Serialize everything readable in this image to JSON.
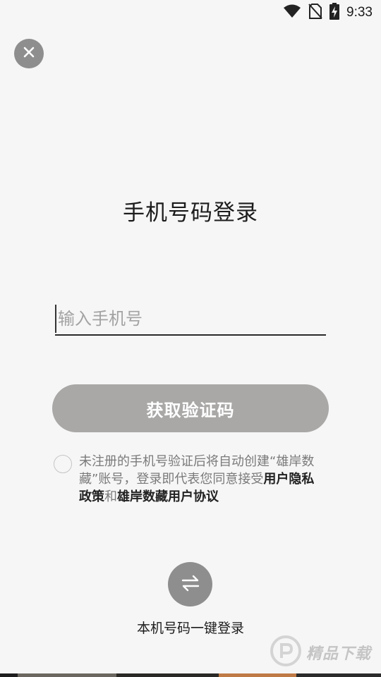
{
  "status_bar": {
    "time": "9:33",
    "icons": [
      "wifi-icon",
      "no-sim-icon",
      "battery-charging-icon"
    ]
  },
  "close_button": {
    "icon": "close-icon"
  },
  "page_title": "手机号码登录",
  "phone_input": {
    "value": "",
    "placeholder": "输入手机号"
  },
  "get_code_button": {
    "label": "获取验证码",
    "state": "disabled",
    "color": "#a9a8a7"
  },
  "agreement": {
    "checked": false,
    "text_prefix": "未注册的手机号验证后将自动创建“雄岸数藏”账号，登录即代表您同意接受",
    "privacy_link": "用户隐私政策",
    "conjunction": "和",
    "terms_link": "雄岸数藏用户协议"
  },
  "switch_login": {
    "icon": "swap-arrows-icon",
    "label": "本机号码一键登录"
  },
  "watermark": {
    "text": "精品下载",
    "icon": "watermark-logo-icon"
  },
  "colors": {
    "background": "#f6f6f6",
    "button_gray": "#a9a8a7",
    "circle_gray": "#8e8e8e",
    "text_dark": "#1c1c1c",
    "text_muted": "#7a7a7a"
  }
}
